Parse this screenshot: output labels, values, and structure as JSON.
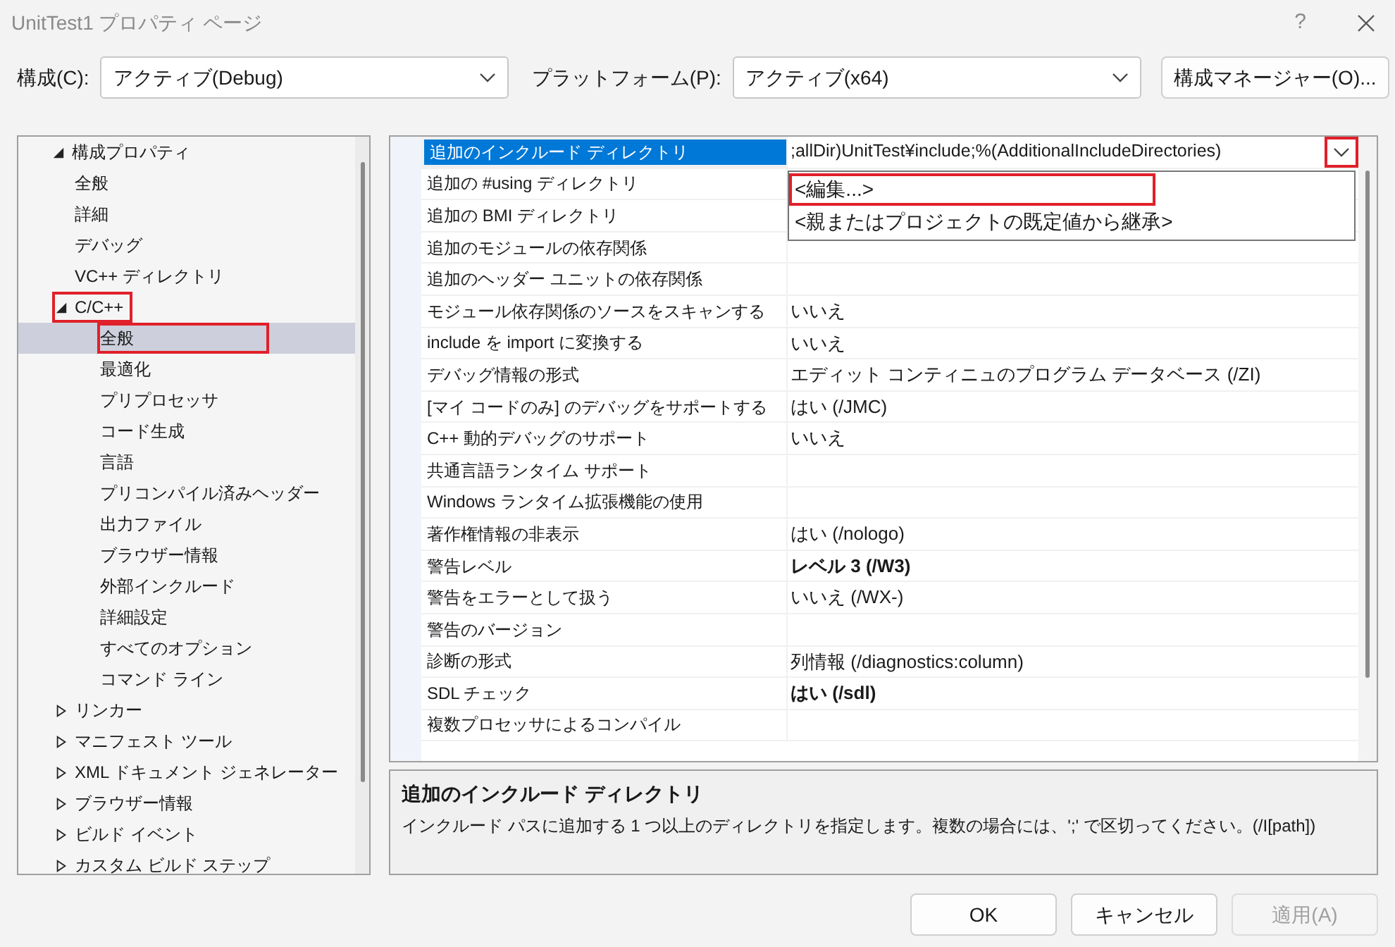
{
  "window": {
    "title": "UnitTest1 プロパティ ページ",
    "help": "?"
  },
  "toolbar": {
    "configuration": {
      "label": "構成(C):",
      "value": "アクティブ(Debug)"
    },
    "platform": {
      "label": "プラットフォーム(P):",
      "value": "アクティブ(x64)"
    },
    "manager_button": "構成マネージャー(O)..."
  },
  "tree": [
    {
      "label": "構成プロパティ",
      "expanded": true,
      "selected": false,
      "highlighted": false,
      "children": [
        {
          "label": "全般",
          "selected": false,
          "highlighted": false
        },
        {
          "label": "詳細",
          "selected": false,
          "highlighted": false
        },
        {
          "label": "デバッグ",
          "selected": false,
          "highlighted": false
        },
        {
          "label": "VC++ ディレクトリ",
          "selected": false,
          "highlighted": false
        },
        {
          "label": "C/C++",
          "expanded": true,
          "selected": false,
          "highlighted": true,
          "children": [
            {
              "label": "全般",
              "selected": true,
              "highlighted": true
            },
            {
              "label": "最適化",
              "selected": false,
              "highlighted": false
            },
            {
              "label": "プリプロセッサ",
              "selected": false,
              "highlighted": false
            },
            {
              "label": "コード生成",
              "selected": false,
              "highlighted": false
            },
            {
              "label": "言語",
              "selected": false,
              "highlighted": false
            },
            {
              "label": "プリコンパイル済みヘッダー",
              "selected": false,
              "highlighted": false
            },
            {
              "label": "出力ファイル",
              "selected": false,
              "highlighted": false
            },
            {
              "label": "ブラウザー情報",
              "selected": false,
              "highlighted": false
            },
            {
              "label": "外部インクルード",
              "selected": false,
              "highlighted": false
            },
            {
              "label": "詳細設定",
              "selected": false,
              "highlighted": false
            },
            {
              "label": "すべてのオプション",
              "selected": false,
              "highlighted": false
            },
            {
              "label": "コマンド ライン",
              "selected": false,
              "highlighted": false
            }
          ]
        },
        {
          "label": "リンカー",
          "expanded": false,
          "selected": false,
          "highlighted": false
        },
        {
          "label": "マニフェスト ツール",
          "expanded": false,
          "selected": false,
          "highlighted": false
        },
        {
          "label": "XML ドキュメント ジェネレーター",
          "expanded": false,
          "selected": false,
          "highlighted": false
        },
        {
          "label": "ブラウザー情報",
          "expanded": false,
          "selected": false,
          "highlighted": false
        },
        {
          "label": "ビルド イベント",
          "expanded": false,
          "selected": false,
          "highlighted": false
        },
        {
          "label": "カスタム ビルド ステップ",
          "expanded": false,
          "selected": false,
          "highlighted": false
        }
      ]
    }
  ],
  "properties": [
    {
      "name": "追加のインクルード ディレクトリ",
      "value": ";allDir)UnitTest¥include;%(AdditionalIncludeDirectories)",
      "bold": false,
      "selected": true,
      "highlighted": true
    },
    {
      "name": "追加の #using ディレクトリ",
      "selected": false,
      "highlighted": false
    },
    {
      "name": "追加の BMI ディレクトリ",
      "selected": false,
      "highlighted": false
    },
    {
      "name": "追加のモジュールの依存関係",
      "selected": false,
      "highlighted": false
    },
    {
      "name": "追加のヘッダー ユニットの依存関係",
      "selected": false,
      "highlighted": false
    },
    {
      "name": "モジュール依存関係のソースをスキャンする",
      "value": "いいえ",
      "bold": false,
      "selected": false,
      "highlighted": false
    },
    {
      "name": "include を import に変換する",
      "value": "いいえ",
      "bold": false,
      "selected": false,
      "highlighted": false
    },
    {
      "name": "デバッグ情報の形式",
      "value": "エディット コンティニュのプログラム データベース (/ZI)",
      "bold": false,
      "selected": false,
      "highlighted": false
    },
    {
      "name": "[マイ コードのみ] のデバッグをサポートする",
      "value": "はい (/JMC)",
      "bold": false,
      "selected": false,
      "highlighted": false
    },
    {
      "name": "C++ 動的デバッグのサポート",
      "value": "いいえ",
      "bold": false,
      "selected": false,
      "highlighted": false
    },
    {
      "name": "共通言語ランタイム サポート",
      "selected": false,
      "highlighted": false
    },
    {
      "name": "Windows ランタイム拡張機能の使用",
      "selected": false,
      "highlighted": false
    },
    {
      "name": "著作権情報の非表示",
      "value": "はい (/nologo)",
      "bold": false,
      "selected": false,
      "highlighted": false
    },
    {
      "name": "警告レベル",
      "value": "レベル 3 (/W3)",
      "bold": true,
      "selected": false,
      "highlighted": false
    },
    {
      "name": "警告をエラーとして扱う",
      "value": "いいえ (/WX-)",
      "bold": false,
      "selected": false,
      "highlighted": false
    },
    {
      "name": "警告のバージョン",
      "selected": false,
      "highlighted": false
    },
    {
      "name": "診断の形式",
      "value": "列情報 (/diagnostics:column)",
      "bold": false,
      "selected": false,
      "highlighted": false
    },
    {
      "name": "SDL チェック",
      "value": "はい (/sdl)",
      "bold": true,
      "selected": false,
      "highlighted": false
    },
    {
      "name": "複数プロセッサによるコンパイル",
      "selected": false,
      "highlighted": false
    }
  ],
  "dropdown": {
    "button_highlighted": true,
    "options": [
      {
        "label": "<編集...>",
        "highlighted": true
      },
      {
        "label": "<親またはプロジェクトの既定値から継承>",
        "highlighted": false
      }
    ]
  },
  "description": {
    "title": "追加のインクルード ディレクトリ",
    "text": "インクルード パスに追加する 1 つ以上のディレクトリを指定します。複数の場合には、';' で区切ってください。(/I[path])"
  },
  "buttons": [
    {
      "label": "OK",
      "disabled": false
    },
    {
      "label": "キャンセル",
      "disabled": false
    },
    {
      "label": "適用(A)",
      "disabled": true
    }
  ]
}
